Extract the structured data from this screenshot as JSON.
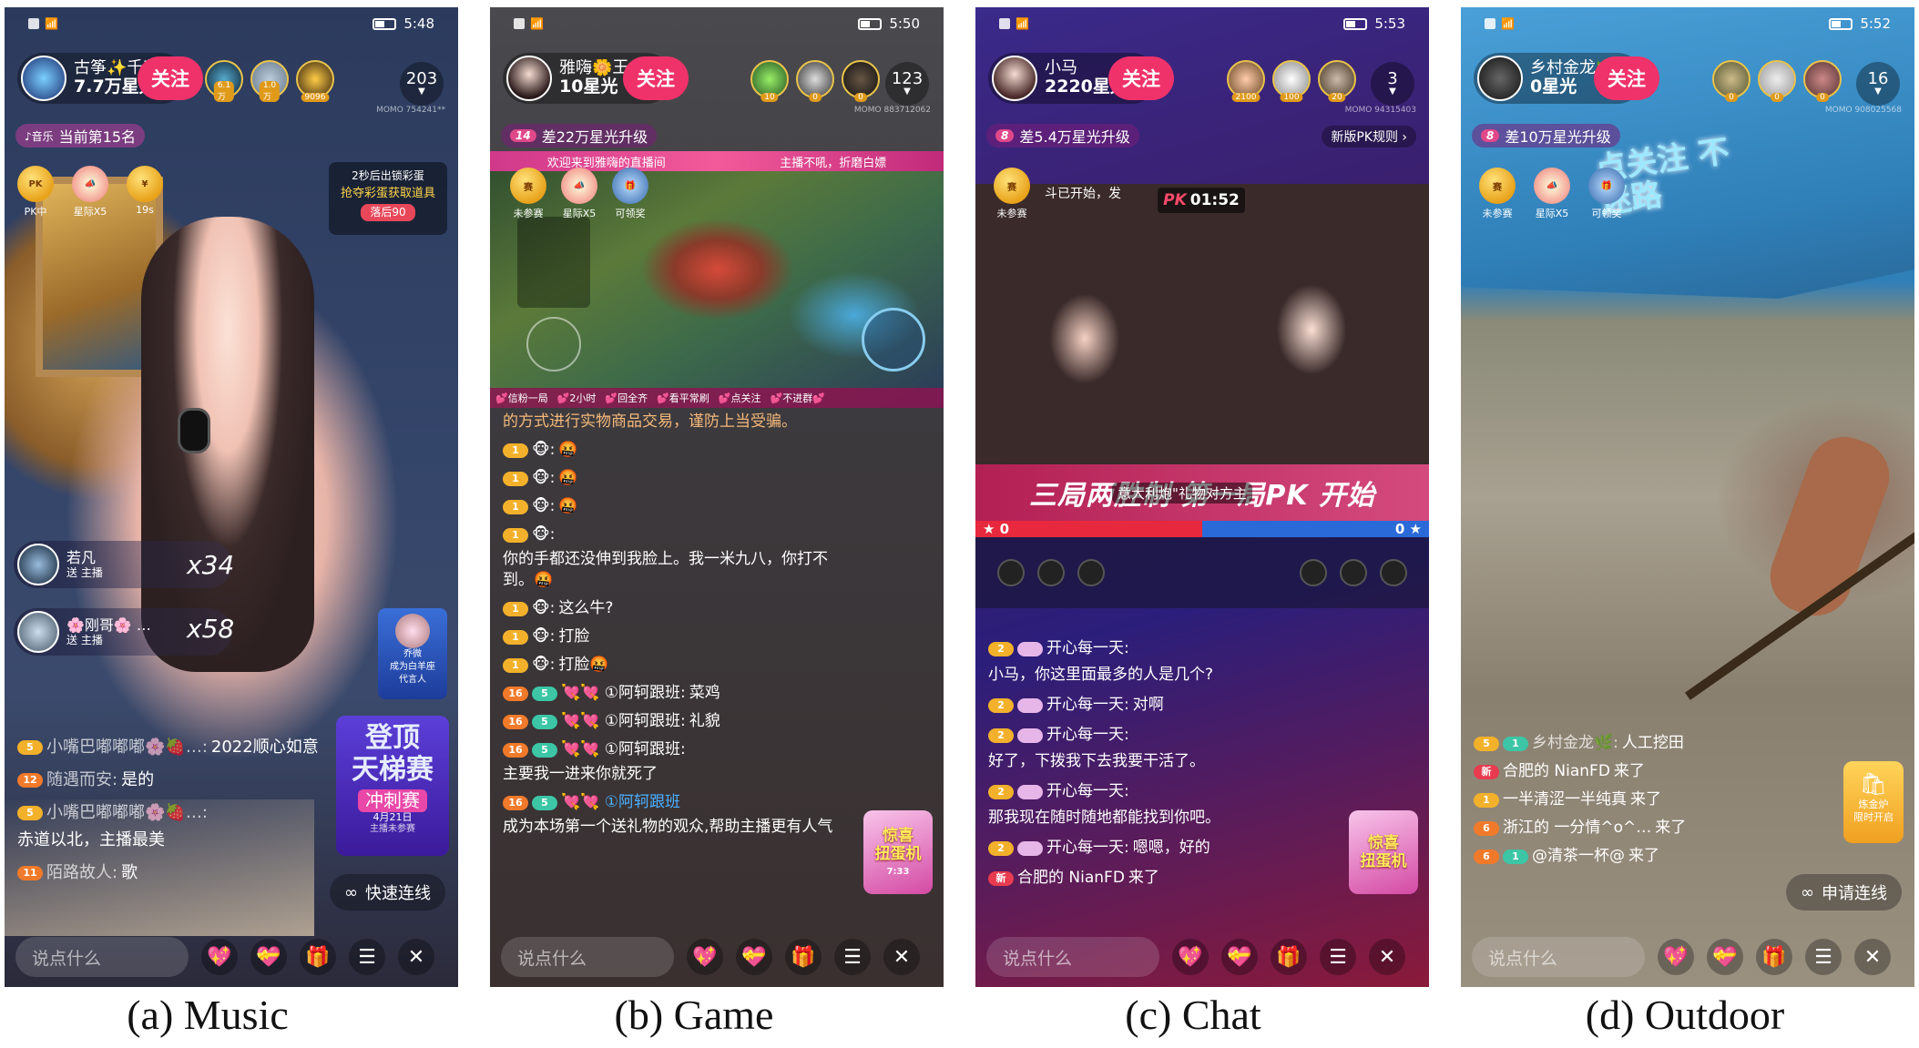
{
  "captions": [
    "(a) Music",
    "(b) Game",
    "(c) Chat",
    "(d) Outdoor"
  ],
  "music": {
    "time": "5:48",
    "host_name": "古筝✨千艺",
    "host_star": "7.7万星光",
    "follow": "关注",
    "viewer_badges": [
      "6.1万",
      "1.0万",
      "9096"
    ],
    "viewer_count": "203",
    "momo": "MOMO 754241**",
    "rank_tag": "♪音乐",
    "rank_text": "当前第15名",
    "icons": [
      {
        "glyph": "",
        "label": "PK中"
      },
      {
        "glyph": "",
        "label": "星际X5"
      },
      {
        "glyph": "",
        "label": "19s"
      }
    ],
    "event_line1": "2秒后出锁彩蛋",
    "event_line2": "抢夺彩蛋获取道具",
    "event_time": "落后90",
    "gifters": [
      {
        "name": "若凡",
        "sub": "送 主播",
        "mult": "x34"
      },
      {
        "name": "🌸刚哥🌸 …",
        "sub": "送 主播",
        "mult": "x58"
      }
    ],
    "spokes": {
      "name": "乔微",
      "line1": "成为白羊座",
      "line2": "代言人"
    },
    "promo": {
      "l1": "登顶",
      "l2": "天梯赛",
      "l3": "冲刺赛",
      "date": "4月21日",
      "sub": "主播未参赛"
    },
    "chat": [
      {
        "badge": "5",
        "name": "小嘴巴嘟嘟嘟🌸🍓…:",
        "text": "2022顺心如意"
      },
      {
        "badge": "12",
        "name": "随遇而安:",
        "text": "是的"
      },
      {
        "badge": "5",
        "name": "小嘴巴嘟嘟嘟🌸🍓…:",
        "text": "赤道以北，主播最美"
      },
      {
        "badge": "11",
        "name": "陌路故人:",
        "text": "歌"
      }
    ],
    "quick_link": "快速连线",
    "say": "说点什么"
  },
  "game": {
    "time": "5:50",
    "host_name": "雅嗨🌼王…",
    "host_star": "10星光",
    "follow": "关注",
    "viewer_badges": [
      "10",
      "0",
      "0"
    ],
    "viewer_count": "123",
    "momo": "MOMO 883712062",
    "level": "14",
    "level_text": "差22万星光升级",
    "banner": "欢迎来到雅嗨的直播间",
    "banner2": "主播不吼，折磨白嫖",
    "icons": [
      {
        "label": "未参赛"
      },
      {
        "label": "星际X5"
      },
      {
        "label": "可领奖"
      }
    ],
    "ticker": [
      "💕信粉一局",
      "💕2小时",
      "💕回全齐",
      "💕看平常刷",
      "💕点关注",
      "💕不进群💕"
    ],
    "chat": [
      {
        "badges": [
          "1"
        ],
        "name": "",
        "text": "的方式进行实物商品交易，谨防上当受骗。"
      },
      {
        "badges": [
          "1"
        ],
        "name": "🐵:",
        "text": "🤬"
      },
      {
        "badges": [
          "1"
        ],
        "name": "🐵:",
        "text": "🤬"
      },
      {
        "badges": [
          "1"
        ],
        "name": "🐵:",
        "text": "🤬"
      },
      {
        "badges": [
          "1"
        ],
        "name": "🐵:",
        "text": "你的手都还没伸到我脸上。我一米九八，你打不到。🤬"
      },
      {
        "badges": [
          "1"
        ],
        "name": "🐵:",
        "text": "这么牛?"
      },
      {
        "badges": [
          "1"
        ],
        "name": "🐵:",
        "text": "打脸"
      },
      {
        "badges": [
          "1"
        ],
        "name": "🐵:",
        "text": "打脸🤬"
      },
      {
        "badges": [
          "16",
          "5"
        ],
        "name": "💘💘 ①阿轲跟班:",
        "text": "菜鸡"
      },
      {
        "badges": [
          "16",
          "5"
        ],
        "name": "💘💘 ①阿轲跟班:",
        "text": "礼貌"
      },
      {
        "badges": [
          "16",
          "5"
        ],
        "name": "💘💘 ①阿轲跟班:",
        "text": "主要我一进来你就死了"
      },
      {
        "badges": [
          "16",
          "5"
        ],
        "name": "💘💘 ①阿轲跟班",
        "text": "成为本场第一个送礼物的观众,帮助主播更有人气"
      }
    ],
    "gift": {
      "l1": "惊喜",
      "l2": "扭蛋机",
      "time": "7:33"
    },
    "say": "说点什么"
  },
  "chatroom": {
    "time": "5:53",
    "host_name": "小马",
    "host_star": "2220星光",
    "follow": "关注",
    "viewer_badges": [
      "2100",
      "100",
      "20"
    ],
    "viewer_count": "3",
    "momo": "MOMO 94315403",
    "level": "8",
    "level_text": "差5.4万星光升级",
    "rule": "新版PK规则 ›",
    "pk_time": "01:52",
    "pk_start": "斗已开始，发",
    "pk_banner": "三局两胜制 第一局PK 开始",
    "pk_gift": "意大利炮\"礼物对方主",
    "score_left": "0",
    "score_right": "0",
    "icons": [
      {
        "label": "未参赛"
      }
    ],
    "chat": [
      {
        "badges": [
          "2"
        ],
        "name": "开心每一天:",
        "text": "小马，你这里面最多的人是几个?"
      },
      {
        "badges": [
          "2"
        ],
        "name": "开心每一天:",
        "text": "对啊"
      },
      {
        "badges": [
          "2"
        ],
        "name": "开心每一天:",
        "text": "好了，下拨我下去我要干活了。"
      },
      {
        "badges": [
          "2"
        ],
        "name": "开心每一天:",
        "text": "那我现在随时随地都能找到你吧。"
      },
      {
        "badges": [
          "2"
        ],
        "name": "开心每一天:",
        "text": "嗯嗯，好的"
      },
      {
        "badges": [
          "新"
        ],
        "name": "合肥的 NianFD",
        "text": "来了"
      }
    ],
    "gift": {
      "l1": "惊喜",
      "l2": "扭蛋机"
    },
    "say": "说点什么"
  },
  "outdoor": {
    "time": "5:52",
    "host_name": "乡村金龙🌿",
    "host_star": "0星光",
    "follow": "关注",
    "viewer_badges": [
      "0",
      "0",
      "0"
    ],
    "viewer_count": "16",
    "momo": "MOMO 908025568",
    "level": "8",
    "level_text": "差10万星光升级",
    "overlay": "点关注 不迷路",
    "icons": [
      {
        "label": "未参赛"
      },
      {
        "label": "星际X5"
      },
      {
        "label": "可领奖"
      }
    ],
    "chat": [
      {
        "badges": [
          "5",
          "1"
        ],
        "name": "乡村金龙🌿:",
        "text": "人工挖田"
      },
      {
        "badges": [
          "新"
        ],
        "name": "合肥的 NianFD",
        "text": "来了"
      },
      {
        "badges": [
          "1"
        ],
        "name": "一半清涩一半纯真",
        "text": "来了"
      },
      {
        "badges": [
          "6"
        ],
        "name": "浙江的 一分情^o^…",
        "text": "来了"
      },
      {
        "badges": [
          "6",
          "1"
        ],
        "name": "@清茶一杯@",
        "text": "来了"
      }
    ],
    "treasure": {
      "l1": "炼金炉",
      "l2": "限时开启"
    },
    "apply": "申请连线",
    "say": "说点什么"
  }
}
